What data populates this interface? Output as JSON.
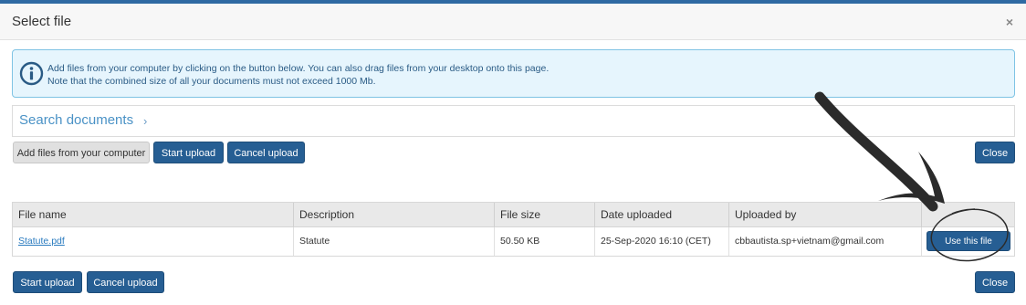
{
  "dialog": {
    "title": "Select file",
    "close_symbol": "×"
  },
  "info": {
    "icon": "info-circle-icon",
    "line1": "Add files from your computer by clicking on the button below. You can also drag files from your desktop onto this page.",
    "line2": "Note that the combined size of all your documents must not exceed 1000 Mb."
  },
  "search": {
    "label": "Search documents",
    "chevron": "›"
  },
  "toolbar_top": {
    "add_files": "Add files from your computer",
    "start_upload": "Start upload",
    "cancel_upload": "Cancel upload",
    "close": "Close"
  },
  "table": {
    "columns": [
      "File name",
      "Description",
      "File size",
      "Date uploaded",
      "Uploaded by",
      ""
    ],
    "rows": [
      {
        "file_name": "Statute.pdf",
        "description": "Statute",
        "file_size": "50.50 KB",
        "date_uploaded": "25-Sep-2020 16:10 (CET)",
        "uploaded_by": "cbbautista.sp+vietnam@gmail.com",
        "action": "Use this file"
      }
    ]
  },
  "toolbar_bottom": {
    "start_upload": "Start upload",
    "cancel_upload": "Cancel upload",
    "close": "Close"
  },
  "colors": {
    "primary": "#265e93",
    "info_bg": "#e6f5fd",
    "info_border": "#7fc3e4",
    "link": "#2a7bbf"
  }
}
